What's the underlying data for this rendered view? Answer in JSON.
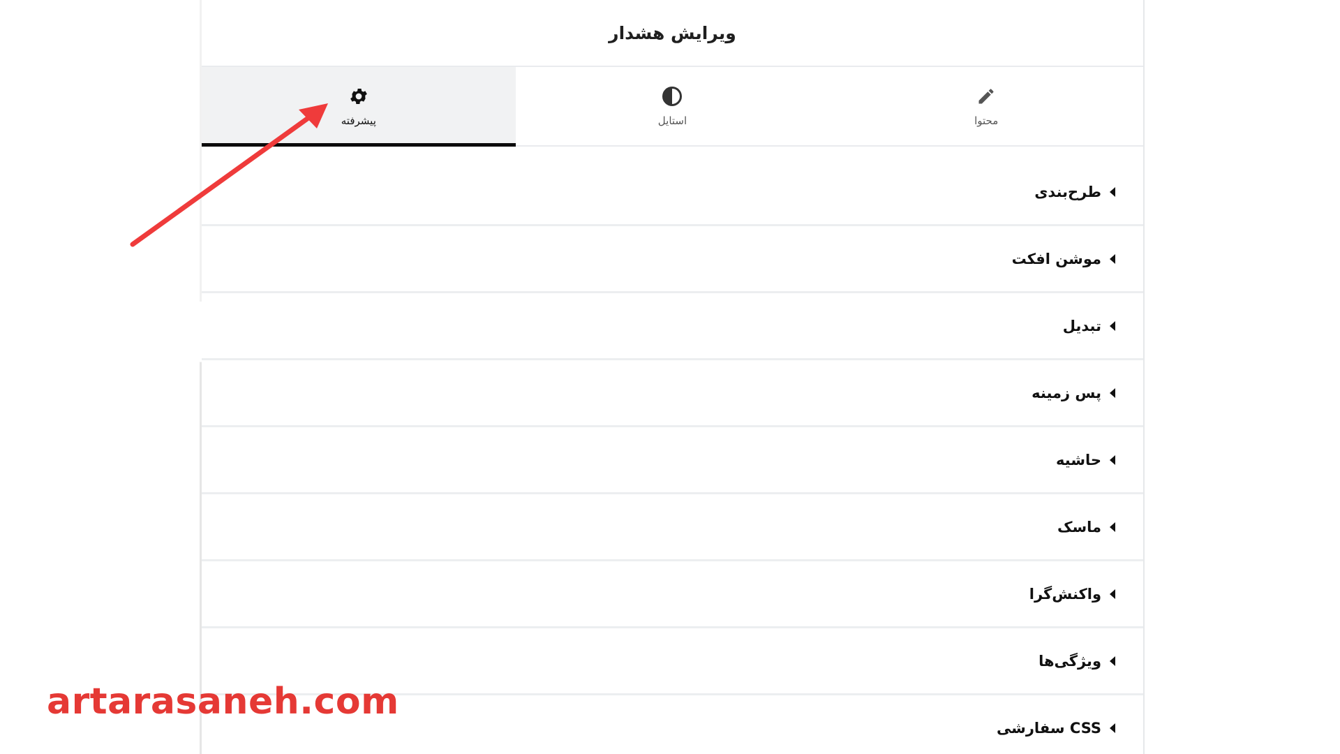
{
  "panel": {
    "title": "ویرایش هشدار"
  },
  "tabs": [
    {
      "label": "محتوا",
      "icon": "pencil-icon",
      "active": false
    },
    {
      "label": "استایل",
      "icon": "half-circle-icon",
      "active": false
    },
    {
      "label": "پیشرفته",
      "icon": "gear-icon",
      "active": true
    }
  ],
  "sections": [
    {
      "label": "طرح‌بندی"
    },
    {
      "label": "موشن افکت"
    },
    {
      "label": "تبدیل"
    },
    {
      "label": "پس زمینه"
    },
    {
      "label": "حاشیه"
    },
    {
      "label": "ماسک"
    },
    {
      "label": "واکنش‌گرا"
    },
    {
      "label": "ویژگی‌ها"
    },
    {
      "label": "CSS سفارشی"
    }
  ],
  "watermark": "artarasaneh.com",
  "colors": {
    "annotation": "#ef3b3b",
    "active_tab_bg": "#f1f2f3",
    "active_underline": "#0b0b0b"
  }
}
